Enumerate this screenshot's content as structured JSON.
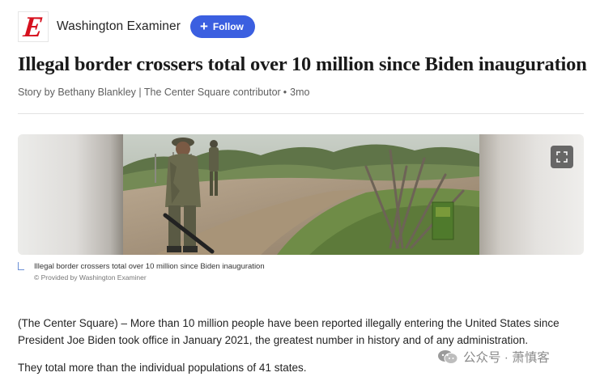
{
  "publisher": {
    "logo_letter": "E",
    "name": "Washington Examiner",
    "follow_label": "Follow"
  },
  "article": {
    "headline": "Illegal border crossers total over 10 million since Biden inauguration",
    "byline": {
      "author": "Story by Bethany Blankley | The Center Square contributor",
      "separator": "•",
      "age": "3mo"
    },
    "image": {
      "caption": "Illegal border crossers total over 10 million since Biden inauguration",
      "credit": "© Provided by Washington Examiner"
    },
    "paragraphs": [
      "(The Center Square) – More than 10 million people have been reported illegally entering the United States since President Joe Biden took office in January 2021, the greatest number in history and of any administration.",
      "They total more than the individual populations of 41 states."
    ]
  },
  "watermark": {
    "text": "公众号 · 萧慎客"
  },
  "colors": {
    "accent": "#3b5fe0",
    "brand_red": "#d6111e",
    "caption_marker": "#6b8fd6"
  },
  "icons": {
    "expand": "expand-icon",
    "plus": "plus-icon",
    "wechat": "wechat-icon"
  }
}
